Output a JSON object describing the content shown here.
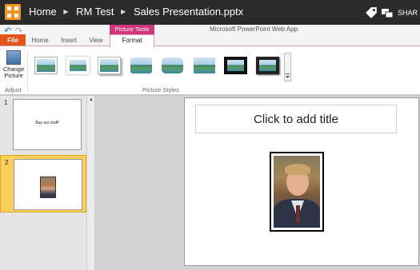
{
  "titlebar": {
    "breadcrumbs": [
      "Home",
      "RM Test",
      "Sales Presentation.pptx"
    ],
    "share_label": "SHAR"
  },
  "tabs": {
    "file": "File",
    "home": "Home",
    "insert": "Insert",
    "view": "View",
    "context_group": "Picture Tools",
    "format": "Format"
  },
  "app_name": "Microsoft PowerPoint Web App",
  "ribbon": {
    "change_picture": "Change Picture",
    "adjust_label": "Adjust",
    "picture_styles_label": "Picture Styles",
    "style_count": 8
  },
  "slides": [
    {
      "number": "1",
      "text": "Buy our stuff!"
    },
    {
      "number": "2",
      "text": ""
    }
  ],
  "selected_slide": 2,
  "slide": {
    "title_placeholder": "Click to add title"
  },
  "colors": {
    "titlebar_bg": "#2b2b2b",
    "file_tab": "#e5531a",
    "context_tab": "#d13580",
    "selected_slide": "#fbd05a",
    "logo": "#f29423"
  }
}
